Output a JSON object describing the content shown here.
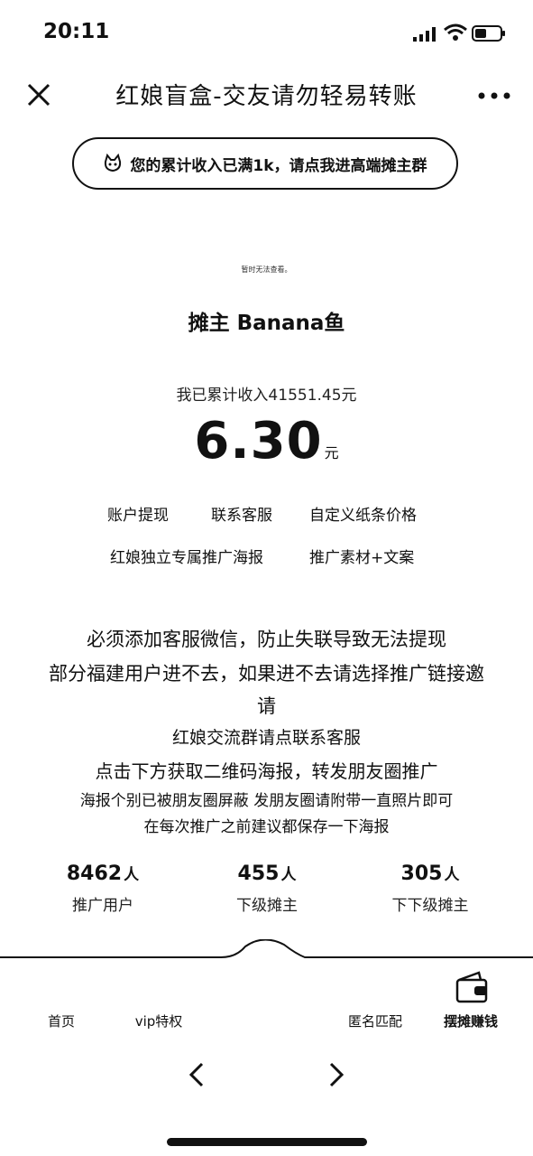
{
  "status_bar": {
    "time": "20:11"
  },
  "nav": {
    "title": "红娘盲盒-交友请勿轻易转账"
  },
  "banner": {
    "text": "您的累计收入已满1k，请点我进高端摊主群"
  },
  "profile": {
    "tiny_note": "暂时无法查看。",
    "owner": "摊主 Banana鱼",
    "income_text": "我已累计收入41551.45元",
    "balance": "6.30",
    "balance_unit": "元"
  },
  "links": {
    "withdraw": "账户提现",
    "service": "联系客服",
    "price": "自定义纸条价格",
    "poster": "红娘独立专属推广海报",
    "material": "推广素材+文案"
  },
  "notices": [
    "必须添加客服微信，防止失联导致无法提现",
    "部分福建用户进不去，如果进不去请选择推广链接邀",
    "请",
    "红娘交流群请点联系客服",
    "点击下方获取二维码海报，转发朋友圈推广",
    "海报个别已被朋友圈屏蔽 发朋友圈请附带一直照片即可",
    "在每次推广之前建议都保存一下海报"
  ],
  "stats": [
    {
      "value": "8462",
      "unit": "人",
      "label": "推广用户"
    },
    {
      "value": "455",
      "unit": "人",
      "label": "下级摊主"
    },
    {
      "value": "305",
      "unit": "人",
      "label": "下下级摊主"
    }
  ],
  "tabbar": {
    "home": "首页",
    "vip": "vip特权",
    "match": "匿名匹配",
    "earn": "摆摊赚钱"
  },
  "icons": [
    "signal-icon",
    "wifi-icon",
    "battery-icon",
    "close-icon",
    "more-icon",
    "cat-icon",
    "wallet-icon",
    "back-icon",
    "forward-icon"
  ]
}
